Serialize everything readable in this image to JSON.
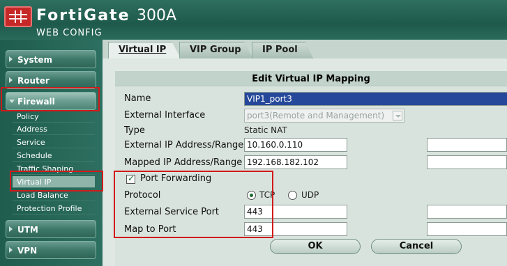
{
  "header": {
    "brand": "FortiGate",
    "model": "300A",
    "subtitle": "WEB CONFIG"
  },
  "sidebar": {
    "menus": [
      {
        "label": "System"
      },
      {
        "label": "Router"
      },
      {
        "label": "Firewall"
      },
      {
        "label": "UTM"
      },
      {
        "label": "VPN"
      }
    ],
    "firewall_items": [
      {
        "label": "Policy"
      },
      {
        "label": "Address"
      },
      {
        "label": "Service"
      },
      {
        "label": "Schedule"
      },
      {
        "label": "Traffic Shaping"
      },
      {
        "label": "Virtual IP"
      },
      {
        "label": "Load Balance"
      },
      {
        "label": "Protection Profile"
      }
    ]
  },
  "tabs": [
    {
      "label": "Virtual IP"
    },
    {
      "label": "VIP Group"
    },
    {
      "label": "IP Pool"
    }
  ],
  "form": {
    "title": "Edit Virtual IP Mapping",
    "name_label": "Name",
    "name_value": "VIP1_port3",
    "ext_iface_label": "External Interface",
    "ext_iface_value": "port3(Remote and Management)",
    "type_label": "Type",
    "type_value": "Static NAT",
    "ext_ip_label": "External IP Address/Range",
    "ext_ip_value": "10.160.0.110",
    "mapped_ip_label": "Mapped IP Address/Range",
    "mapped_ip_value": "192.168.182.102",
    "port_forwarding_label": "Port Forwarding",
    "port_forwarding_checked": true,
    "protocol_label": "Protocol",
    "protocol_tcp": "TCP",
    "protocol_udp": "UDP",
    "protocol_selected": "TCP",
    "ext_service_port_label": "External Service Port",
    "ext_service_port_value": "443",
    "map_to_port_label": "Map to Port",
    "map_to_port_value": "443",
    "ok_label": "OK",
    "cancel_label": "Cancel"
  },
  "colors": {
    "accent": "#2d6f60",
    "highlight_box": "#d11a1a"
  }
}
